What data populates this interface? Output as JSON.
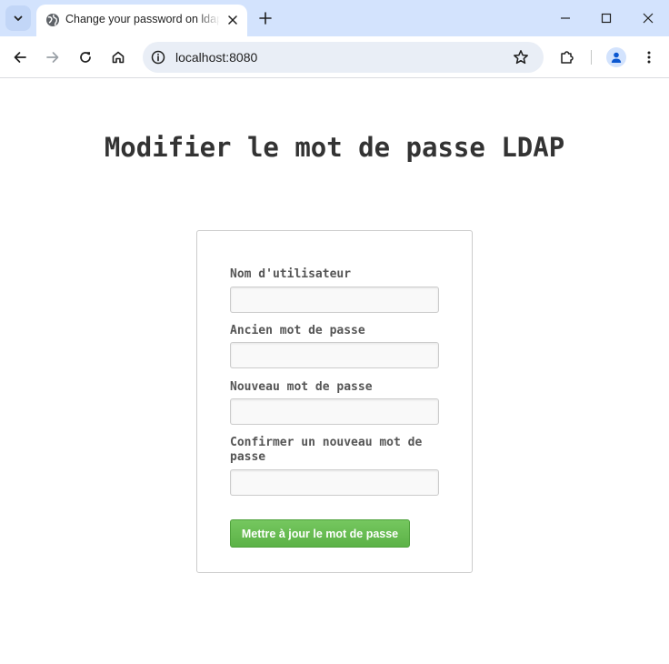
{
  "browser": {
    "tab_title": "Change your password on ldap",
    "url": "localhost:8080",
    "icons": {
      "tab_search": "chevron-down-icon",
      "favicon": "globe-icon",
      "tab_close": "close-icon",
      "new_tab": "plus-icon",
      "minimize": "minimize-icon",
      "maximize": "maximize-icon",
      "close_window": "close-icon",
      "back": "arrow-left-icon",
      "forward": "arrow-right-icon",
      "reload": "reload-icon",
      "home": "home-icon",
      "site_info": "info-icon",
      "bookmark": "star-icon",
      "extensions": "puzzle-icon",
      "profile": "person-icon",
      "menu": "more-vertical-icon"
    },
    "colors": {
      "tabstrip": "#d3e3fd",
      "omnibox": "#e9eef6"
    }
  },
  "page": {
    "title": "Modifier le mot de passe LDAP",
    "form": {
      "fields": [
        {
          "label": "Nom d'utilisateur",
          "value": ""
        },
        {
          "label": "Ancien mot de passe",
          "value": ""
        },
        {
          "label": "Nouveau mot de passe",
          "value": ""
        },
        {
          "label": "Confirmer un nouveau mot de passe",
          "value": ""
        }
      ],
      "submit_label": "Mettre à jour le mot de passe"
    },
    "colors": {
      "button": "#5cb247",
      "title_text": "#333333",
      "label_text": "#555555"
    }
  }
}
